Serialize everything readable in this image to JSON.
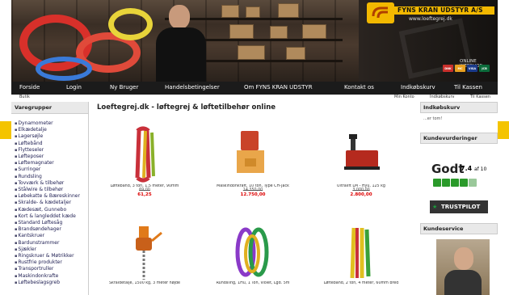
{
  "brand": {
    "name": "FYNS KRAN UDSTYR A/S",
    "url": "www.loeftegrej.dk",
    "webshop_label": "ONLINE WEBSHOP"
  },
  "payment_cards": [
    {
      "label": "DNK",
      "color": "#c9302c"
    },
    {
      "label": "MC",
      "color": "#e8a020"
    },
    {
      "label": "VISA",
      "color": "#1a3a8a"
    },
    {
      "label": "JCB",
      "color": "#0b6a3a"
    }
  ],
  "nav": [
    "Forside",
    "Login",
    "Ny Bruger",
    "Handelsbetingelser",
    "Om FYNS KRAN UDSTYR",
    "Kontakt os",
    "Indkøbskurv",
    "Til Kassen"
  ],
  "subnav": {
    "left": "Butik",
    "right": [
      "Min Konto",
      "Indkøbskurv",
      "Til Kassen"
    ]
  },
  "sidebar": {
    "title": "Varegrupper",
    "items": [
      "Dynamometer",
      "Elkædetalje",
      "Lagersøjle",
      "Løftebånd",
      "Flytteseler",
      "Løfteposer",
      "Løftemagnater",
      "Surringer",
      "Rundsling",
      "Tovværk & tilbehør",
      "Stålwire & tilbehør",
      "Løbekatte & Bæreskinner",
      "Skralde- & kædetaljer",
      "Kædesæt, Gunnebo",
      "Kort & langleddet kæde",
      "Standard Løftesåg",
      "Brandsøndehager",
      "Kantskruer",
      "Bardunstrammer",
      "Sjækler",
      "Ringskruer & Møtrikker",
      "Rustfrie produkter",
      "Transportruller",
      "Maskindonkrafte",
      "Løftebeslagsgreb"
    ]
  },
  "main": {
    "title": "Loeftegrej.dk - løftegrej & løftetilbehør online",
    "products": [
      {
        "name": "Løftebånd, 3 ton, 1,5 meter, 90mm",
        "old": "69,00",
        "price": "61,25"
      },
      {
        "name": "Maskindonkraft, 10 ton, Type CH-Jack",
        "old": "14.350,00",
        "price": "12.750,00"
      },
      {
        "name": "Ultralift LM - Hyu, 125 kg",
        "old": "3.000,00",
        "price": "2.800,00"
      },
      {
        "name": "Skraldetalje, 1500 kg, 3 meter højde",
        "old": "",
        "price": ""
      },
      {
        "name": "Rundsling, 1Hu, 1 Ton, violet, Lgd. 5m",
        "old": "",
        "price": ""
      },
      {
        "name": "Løftebånd, 2 ton, 4 meter, 60mm bred",
        "old": "",
        "price": ""
      }
    ]
  },
  "right": {
    "cart_title": "Indkøbskurv",
    "cart_empty": "...er tom!",
    "reviews_title": "Kundevurderinger",
    "review_word": "Godt",
    "review_score": "7.4",
    "review_suffix": "af 10",
    "stars": 4,
    "trustpilot": "TRUSTPILOT",
    "service_title": "Kundeservice"
  }
}
